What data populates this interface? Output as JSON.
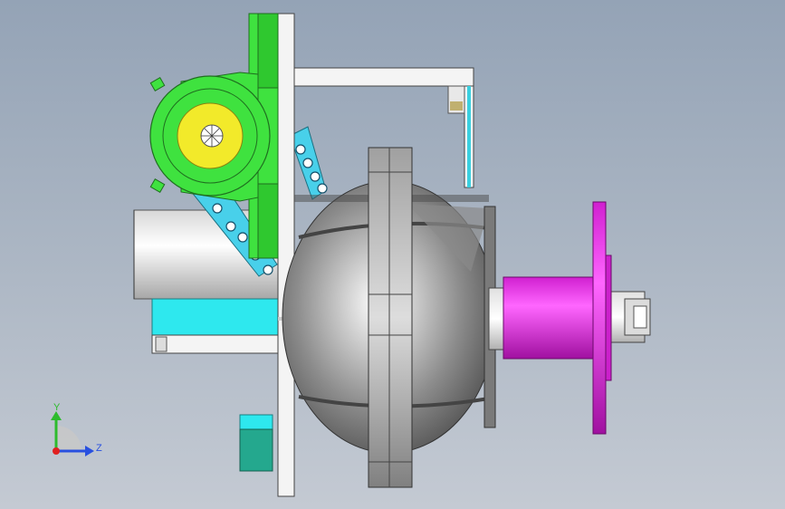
{
  "viewport": {
    "colors": {
      "background_top": "#94a3b6",
      "background_bottom": "#c4cad3",
      "plate": "#f4f4f4",
      "bearing": "#3fe23f",
      "hub": "#f2ea2a",
      "chain": "#48d0ea",
      "drum": "#9a9a9a",
      "shaft_collar": "#ee22ee",
      "cyan_block": "#2ee8ee",
      "teal_block": "#24a88e"
    }
  },
  "triad": {
    "y_label": "Y",
    "z_label": "Z",
    "colors": {
      "y": "#2dbb2d",
      "z": "#2850e0",
      "x": "#e02020"
    }
  }
}
